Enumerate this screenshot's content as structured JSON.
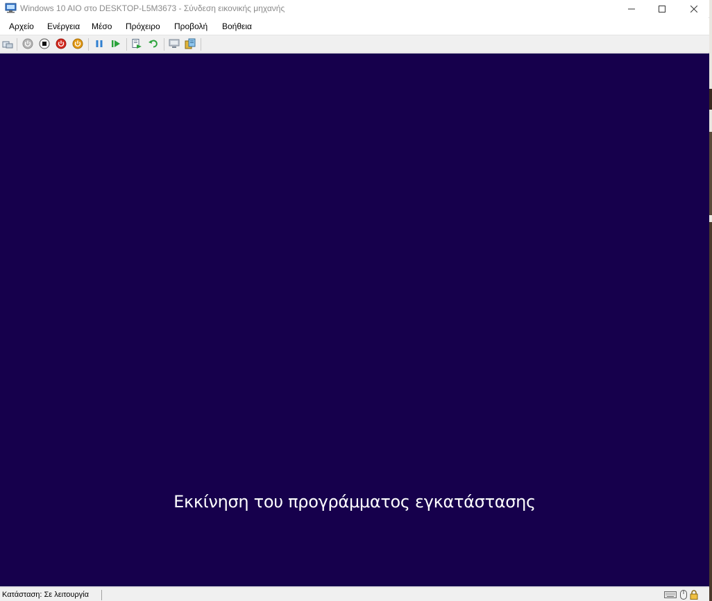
{
  "window": {
    "title": "Windows 10 AIO στο DESKTOP-L5M3673 - Σύνδεση εικονικής μηχανής",
    "minimize_glyph": "—",
    "maximize_glyph": "☐",
    "close_glyph": "✕"
  },
  "menu": {
    "items": [
      "Αρχείο",
      "Ενέργεια",
      "Μέσο",
      "Πρόχειρο",
      "Προβολή",
      "Βοήθεια"
    ]
  },
  "toolbar": {
    "icons": [
      "ctrl-alt-del-icon",
      "start-icon",
      "turn-off-icon",
      "shutdown-icon",
      "save-state-icon",
      "pause-icon",
      "resume-icon",
      "checkpoint-icon",
      "revert-icon",
      "enhanced-session-icon",
      "share-icon"
    ]
  },
  "vm": {
    "background_color": "#16004c",
    "message": "Εκκίνηση του προγράμματος εγκατάστασης"
  },
  "status": {
    "text": "Κατάσταση: Σε λειτουργία",
    "icons": [
      "keyboard-icon",
      "mouse-icon",
      "lock-icon"
    ]
  }
}
